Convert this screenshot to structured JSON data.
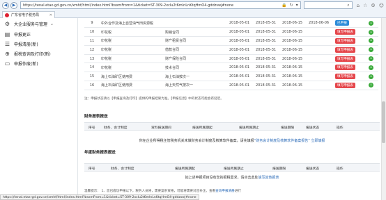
{
  "browser": {
    "url": "https://tenal.etax-gd.gov.cn/xmhf/html/index.html?bsxmFrom=1&ticket=ST-309-2xcIu2t6mInLnKtqHmO4-gddzswj#none",
    "tab_title": "广东省电子税务局",
    "search_placeholder": "",
    "back_glyph": "◀",
    "forward_glyph": "▶"
  },
  "sidebar": {
    "items": [
      {
        "label": "大企业服务与管理",
        "icon": "building-icon"
      },
      {
        "label": "申报更正",
        "icon": "document-edit-icon"
      },
      {
        "label": "申报清册(新)",
        "icon": "list-icon"
      },
      {
        "label": "报税查询及打印(新)",
        "icon": "print-icon"
      },
      {
        "label": "申报作废(新)",
        "icon": "document-cancel-icon"
      }
    ]
  },
  "table": {
    "rows": [
      {
        "no": "9",
        "name": "中外合作及海上自营油气田资源税",
        "d1": "",
        "d2": "2018-05-01",
        "d3": "2018-05-31",
        "d4": "2018-06-15",
        "d5": "2018-06-06",
        "action": "已申报",
        "action_type": "done"
      },
      {
        "no": "10",
        "name": "印花税",
        "d1": "购销合同",
        "d2": "2018-05-01",
        "d3": "2018-05-31",
        "d4": "2018-06-15",
        "d5": "",
        "action": "填写申报表",
        "action_type": "fill"
      },
      {
        "no": "11",
        "name": "印花税",
        "d1": "财产租赁合同",
        "d2": "2018-05-01",
        "d3": "2018-05-31",
        "d4": "2018-06-15",
        "d5": "",
        "action": "填写申报表",
        "action_type": "fill"
      },
      {
        "no": "12",
        "name": "印花税",
        "d1": "借款合同",
        "d2": "2018-05-01",
        "d3": "2018-05-31",
        "d4": "2018-06-15",
        "d5": "",
        "action": "填写申报表",
        "action_type": "fill"
      },
      {
        "no": "13",
        "name": "印花税",
        "d1": "财产保险合同",
        "d2": "2018-05-01",
        "d3": "2018-05-31",
        "d4": "2018-06-15",
        "d5": "",
        "action": "填写申报表",
        "action_type": "fill"
      },
      {
        "no": "14",
        "name": "印花税",
        "d1": "技术合同",
        "d2": "2018-05-01",
        "d3": "2018-05-31",
        "d4": "2018-06-15",
        "d5": "",
        "action": "填写申报表",
        "action_type": "fill"
      },
      {
        "no": "15",
        "name": "海上石油矿区使用费",
        "d1": "海上石油按次一",
        "d2": "2018-05-01",
        "d3": "2018-05-31",
        "d4": "2018-06-15",
        "d5": "",
        "action": "填写申报表",
        "action_type": "fill"
      },
      {
        "no": "16",
        "name": "海上石油矿区使用费",
        "d1": "海上天然气按次一",
        "d2": "2018-05-01",
        "d3": "2018-05-31",
        "d4": "2018-06-15",
        "d5": "",
        "action": "填写申报表",
        "action_type": "fill"
      }
    ],
    "download_glyph": "↓"
  },
  "note_text": "注：申报状态请以【申报查询及打印】提供的申报结果为准。【申报信息】中的状态可能会有延迟。",
  "financial_report": {
    "title": "财务报表报送",
    "headers": [
      "序号",
      "财务、会计制度",
      "资料报送期间",
      "报送所属期起",
      "报送所属期止",
      "报送期限",
      "报送状态",
      "操作"
    ],
    "message": "你在企业所得税主管税务机关未做财务会计制度及核算软件备案，请先填报",
    "message_link": "“财务会计制度及核算软件备案报告”",
    "message_cta": "立即填报"
  },
  "annual_report": {
    "title": "年度财务报表报送",
    "headers": [
      "序号",
      "财务、会计制度",
      "报送所属期起",
      "报送所属期止",
      "报送期限",
      "报送状态",
      "操作"
    ],
    "message": "如上述申报项目没有您的报税需求，请点击此处",
    "message_link": "填写其他报表"
  },
  "tip": {
    "label": "温馨提示：",
    "text": "1、您已成功申报以下，税务人员将，需要复杂资格，可能将需要对应补正。查看",
    "link": "查询申报清册",
    "tail": "进行"
  },
  "status_url": "https://tenal.etax-gd.gov.cn/xmhf/html/index.html?bsxmFrom=1&ticket=ST-309-2xcIu2t6mInLnKtqHmO4-gddzswj#none"
}
